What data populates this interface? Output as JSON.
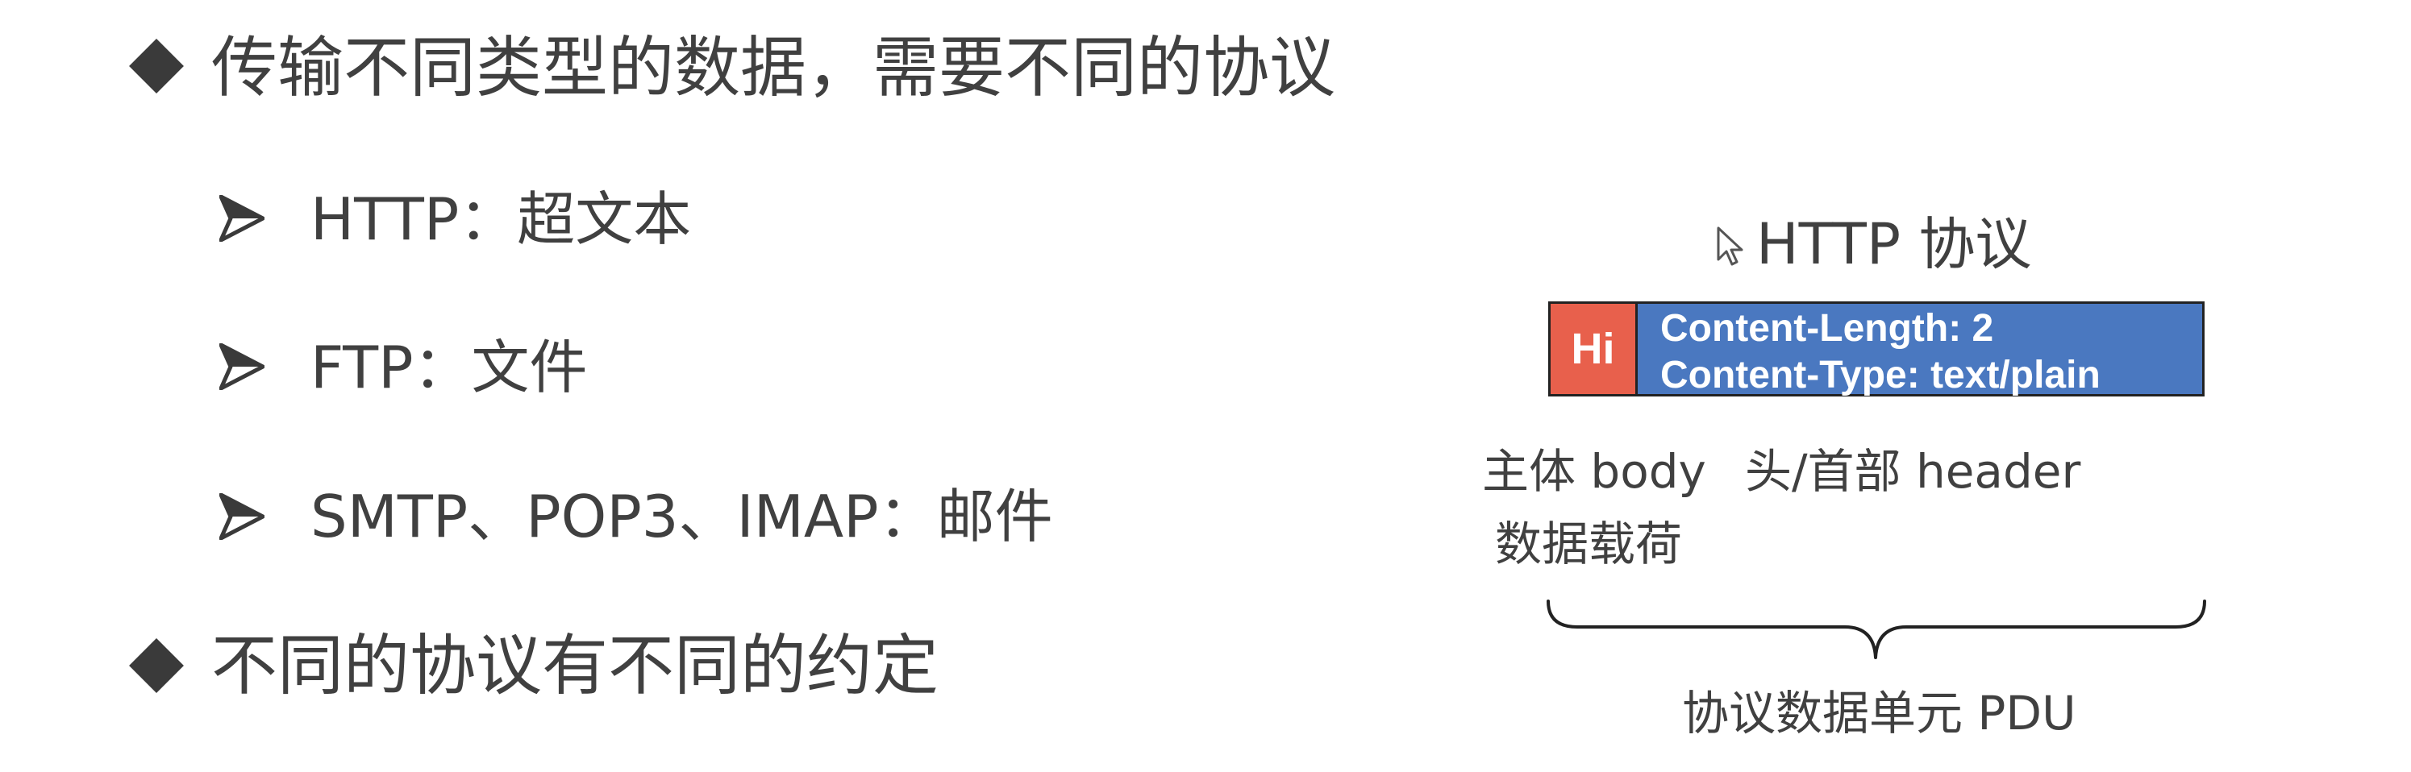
{
  "bullets": {
    "first": "传输不同类型的数据，需要不同的协议",
    "second": "不同的协议有不同的约定"
  },
  "sub_items": [
    "HTTP：超文本",
    "FTP：文件",
    "SMTP、POP3、IMAP：邮件"
  ],
  "diagram": {
    "title": "HTTP 协议",
    "packet": {
      "body_text": "Hi",
      "header_line_1": "Content-Length: 2",
      "header_line_2": "Content-Type: text/plain"
    },
    "labels": {
      "body": "主体 body",
      "header": "头/首部 header",
      "payload": "数据载荷",
      "pdu": "协议数据单元 PDU"
    }
  },
  "colors": {
    "body_fill": "#e8604c",
    "header_fill": "#4a78c0",
    "text": "#404040"
  },
  "icons": {
    "bullet_main": "diamond-icon",
    "bullet_sub": "arrowhead-icon",
    "pointer": "mouse-cursor-icon",
    "brace": "curly-brace-icon"
  }
}
